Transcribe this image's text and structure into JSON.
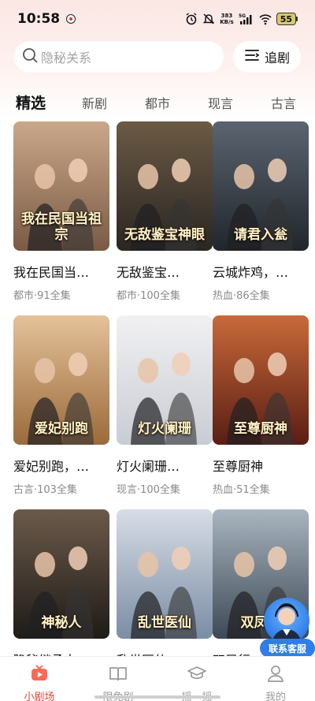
{
  "status_bar": {
    "time": "10:58",
    "net_speed": "383",
    "net_unit": "KB/s",
    "signal": "5G",
    "battery": "55"
  },
  "search": {
    "placeholder": "隐秘关系"
  },
  "follow_button": {
    "label": "追剧"
  },
  "tabs": [
    {
      "label": "精选",
      "active": true
    },
    {
      "label": "新剧"
    },
    {
      "label": "都市"
    },
    {
      "label": "现言"
    },
    {
      "label": "古言"
    }
  ],
  "dramas": [
    {
      "title": "我在民国当…",
      "meta": "都市·91全集",
      "poster_text": "我在民国当祖宗",
      "colors": [
        "#7a5a44",
        "#c9a88a"
      ]
    },
    {
      "title": "无敌鉴宝…",
      "meta": "都市·100全集",
      "poster_text": "无敌鉴宝神眼",
      "colors": [
        "#2a2622",
        "#6b5a44"
      ]
    },
    {
      "title": "云城炸鸡，…",
      "meta": "热血·86全集",
      "poster_text": "请君入瓮",
      "colors": [
        "#20262c",
        "#5b6470"
      ]
    },
    {
      "title": "爱妃别跑，…",
      "meta": "古言·103全集",
      "poster_text": "爱妃别跑",
      "colors": [
        "#9b6a3a",
        "#e4c29a"
      ]
    },
    {
      "title": "灯火阑珊…",
      "meta": "现言·100全集",
      "poster_text": "灯火阑珊",
      "colors": [
        "#c9ccd3",
        "#f1f1f3"
      ]
    },
    {
      "title": "至尊厨神",
      "meta": "热血·51全集",
      "poster_text": "至尊厨神",
      "colors": [
        "#5a1d14",
        "#c86a3a"
      ]
    },
    {
      "title": "隐秘继承人",
      "meta": "",
      "poster_text": "神秘人",
      "colors": [
        "#1f1b18",
        "#6b5a4a"
      ]
    },
    {
      "title": "乱世医仙",
      "meta": "",
      "poster_text": "乱世医仙",
      "colors": [
        "#7a8da4",
        "#d7dde6"
      ]
    },
    {
      "title": "双凤行",
      "meta": "",
      "poster_text": "双凤行",
      "colors": [
        "#3c4a56",
        "#a9b5bf"
      ]
    }
  ],
  "service": {
    "label": "联系客服"
  },
  "bottom_nav": [
    {
      "label": "小剧场",
      "icon": "tv-icon",
      "active": true
    },
    {
      "label": "限免剧",
      "icon": "book-icon"
    },
    {
      "label": "摇一摇",
      "icon": "mortarboard-icon"
    },
    {
      "label": "我的",
      "icon": "person-icon"
    }
  ],
  "accent_color": "#e8453c"
}
